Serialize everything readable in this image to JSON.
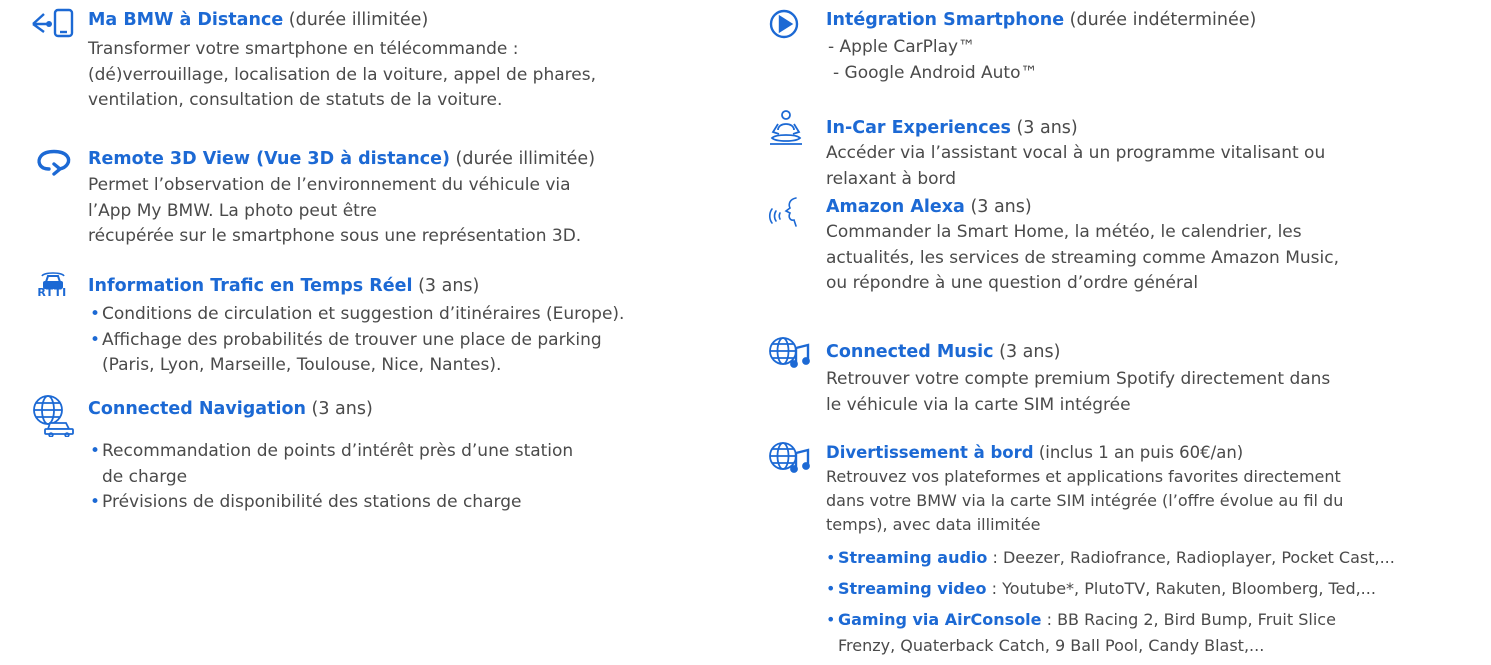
{
  "colors": {
    "accent": "#1c69d4",
    "text": "#4a4a4a"
  },
  "left": {
    "bmw_remote": {
      "icon": "phone-remote-icon",
      "title": "Ma BMW à Distance",
      "duration": "(durée illimitée)",
      "lines": [
        "Transformer votre smartphone en télécommande :",
        "(dé)verrouillage, localisation de la voiture, appel de phares,",
        "ventilation, consultation de statuts de la voiture."
      ]
    },
    "remote_3d": {
      "icon": "rotate-view-icon",
      "title": "Remote 3D View (Vue 3D à distance)",
      "duration": "(durée illimitée)",
      "lines": [
        "Permet l’observation de l’environnement du véhicule via",
        "l’App My BMW. La photo peut être",
        "récupérée sur le smartphone sous une représentation 3D."
      ]
    },
    "rtti": {
      "icon": "rtti-car-icon",
      "icon_label": "RTTI",
      "title": "Information Trafic en Temps Réel",
      "duration": "(3 ans)",
      "bullets": [
        [
          "Conditions de circulation et suggestion d’itinéraires (Europe)."
        ],
        [
          "Affichage des probabilités de trouver une place de parking",
          "(Paris, Lyon, Marseille, Toulouse, Nice, Nantes)."
        ]
      ]
    },
    "navigation": {
      "icon": "globe-car-icon",
      "title": "Connected Navigation",
      "duration": "(3 ans)",
      "bullets": [
        [
          "Recommandation de points d’intérêt près d’une station",
          "de charge"
        ],
        [
          "Prévisions de disponibilité des stations de charge"
        ]
      ]
    }
  },
  "right": {
    "smartphone": {
      "icon": "play-circle-icon",
      "title": "Intégration Smartphone",
      "duration": "(durée indéterminée)",
      "lines": [
        "- Apple CarPlay™",
        "- Google Android Auto™"
      ]
    },
    "incar": {
      "icon": "meditation-icon",
      "title": "In-Car Experiences",
      "duration": "(3 ans)",
      "lines": [
        "Accéder via l’assistant vocal à un programme vitalisant ou",
        "relaxant à bord"
      ]
    },
    "alexa": {
      "icon": "voice-assistant-icon",
      "title": "Amazon Alexa",
      "duration": "(3 ans)",
      "lines": [
        "Commander la Smart Home, la météo, le calendrier, les",
        "actualités, les services de streaming comme Amazon Music,",
        "ou répondre à une question d’ordre général"
      ]
    },
    "music": {
      "icon": "globe-music-icon",
      "title": "Connected Music",
      "duration": "(3 ans)",
      "lines": [
        "Retrouver votre compte premium Spotify directement dans",
        "le véhicule via la carte SIM intégrée"
      ]
    },
    "entertainment": {
      "icon": "globe-music-icon",
      "title": "Divertissement à bord",
      "duration": "(inclus 1 an puis 60€/an)",
      "lines": [
        "Retrouvez vos plateformes et applications favorites directement",
        "dans votre BMW via la carte SIM intégrée (l’offre évolue au fil du",
        "temps), avec data illimitée"
      ],
      "bullets": [
        {
          "label": "Streaming audio",
          "text": " : Deezer, Radiofrance, Radioplayer, Pocket Cast,..."
        },
        {
          "label": "Streaming video",
          "text": " : Youtube*, PlutoTV, Rakuten, Bloomberg, Ted,..."
        },
        {
          "label": "Gaming via AirConsole",
          "text": " : BB Racing 2, Bird Bump, Fruit Slice",
          "cont": "Frenzy, Quaterback Catch, 9 Ball Pool, Candy Blast,..."
        }
      ]
    }
  }
}
